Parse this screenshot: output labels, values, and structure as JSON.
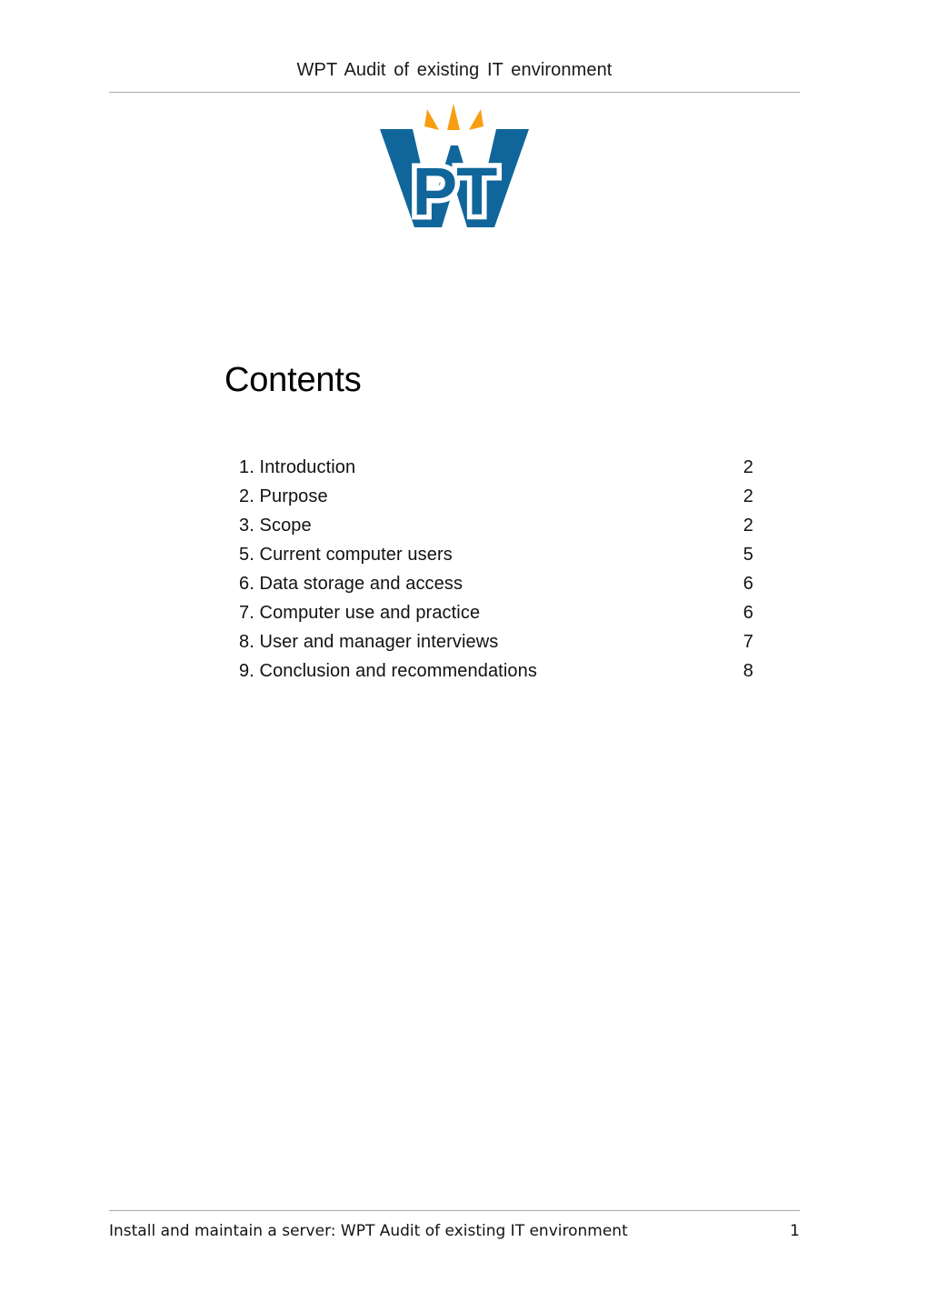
{
  "document": {
    "header_title": "WPT Audit of existing IT environment",
    "heading": "Contents"
  },
  "logo": {
    "name": "wpt-logo",
    "letters": "PT",
    "wordmark": "W",
    "blue": "#10669B",
    "orange": "#F99D12",
    "white": "#FFFFFF"
  },
  "toc": {
    "entries": [
      {
        "label": "1. Introduction",
        "page": "2"
      },
      {
        "label": "2. Purpose",
        "page": "2"
      },
      {
        "label": "3. Scope",
        "page": "2"
      },
      {
        "label": "5. Current computer users",
        "page": "5"
      },
      {
        "label": "6. Data storage and access",
        "page": "6"
      },
      {
        "label": "7. Computer use and practice",
        "page": "6"
      },
      {
        "label": "8. User and manager interviews",
        "page": "7"
      },
      {
        "label": "9. Conclusion and recommendations",
        "page": "8"
      }
    ]
  },
  "footer": {
    "text": "Install and maintain a server: WPT Audit of existing IT environment",
    "page": "1"
  },
  "colors": {
    "rule": "#a8a8a8",
    "text": "#000000",
    "background": "#ffffff"
  }
}
